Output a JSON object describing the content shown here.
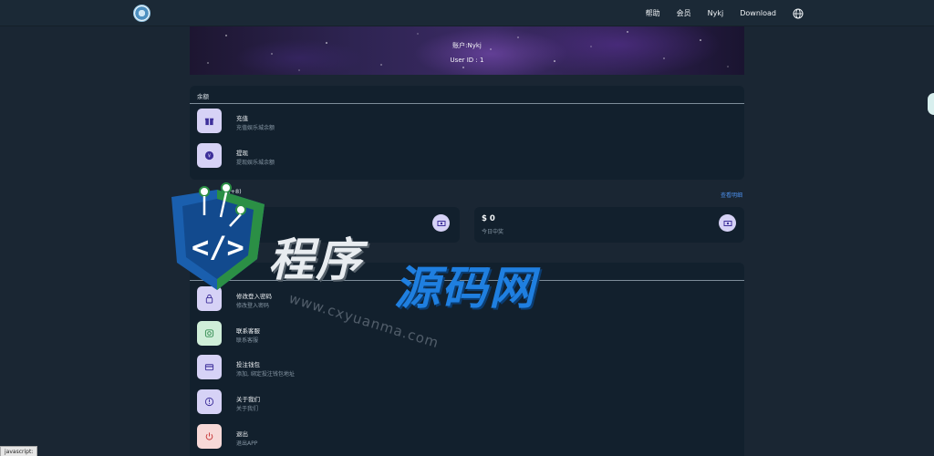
{
  "header": {
    "nav": [
      "帮助",
      "会员",
      "Nykj",
      "Download"
    ]
  },
  "banner": {
    "account": "账户:Nykj",
    "user_id": "User ID : 1"
  },
  "balance_section": {
    "title": "余额",
    "items": [
      {
        "title": "充值",
        "subtitle": "充值娱乐城余额",
        "icon": "gift-icon"
      },
      {
        "title": "提现",
        "subtitle": "提现娱乐城余额",
        "icon": "withdraw-icon"
      }
    ]
  },
  "stats": {
    "heading_suffix": "(+8)",
    "link": "查看明细",
    "boxes": [
      {
        "value": "",
        "label": "",
        "icon": "money-icon"
      },
      {
        "value": "$ 0",
        "label": "今日中奖",
        "icon": "money-icon"
      }
    ]
  },
  "settings_section": {
    "items": [
      {
        "title": "修改登入密码",
        "subtitle": "修改登入密码",
        "icon": "lock-icon",
        "color": "purple"
      },
      {
        "title": "联系客服",
        "subtitle": "联系客服",
        "icon": "support-icon",
        "color": "green"
      },
      {
        "title": "投注钱包",
        "subtitle": "添加, 绑定投注钱包地址",
        "icon": "wallet-icon",
        "color": "purple"
      },
      {
        "title": "关于我们",
        "subtitle": "关于我们",
        "icon": "info-icon",
        "color": "purple"
      },
      {
        "title": "退出",
        "subtitle": "退出APP",
        "icon": "power-icon",
        "color": "red"
      }
    ]
  },
  "watermark": {
    "cn_part1": "程序",
    "cn_part2": "源码网",
    "url": "www.cxyuanma.com"
  },
  "status_bar": "javascript:",
  "colors": {
    "background": "#1a2633",
    "card": "#12202d",
    "accent_blue": "#4c8ee8",
    "icon_purple": "#d6d2f6"
  }
}
